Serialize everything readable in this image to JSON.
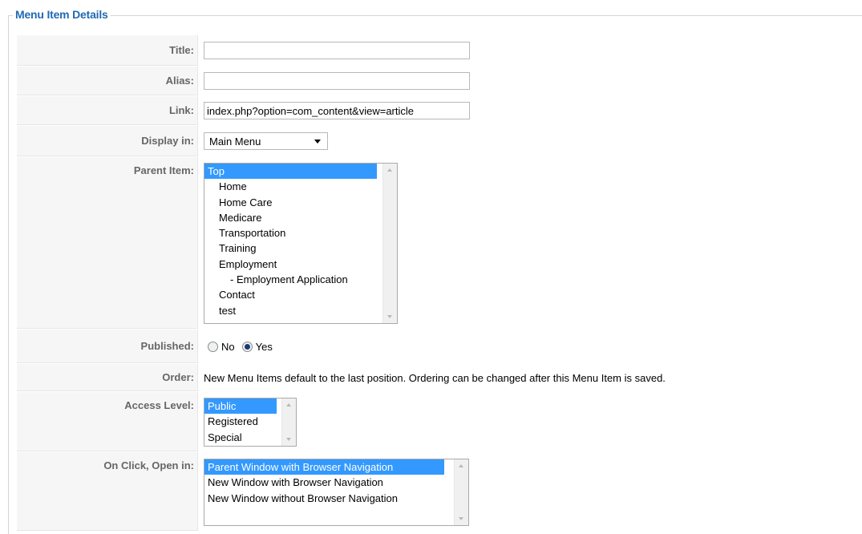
{
  "legend": "Menu Item Details",
  "fields": {
    "title": {
      "label": "Title:",
      "value": ""
    },
    "alias": {
      "label": "Alias:",
      "value": ""
    },
    "link": {
      "label": "Link:",
      "value": "index.php?option=com_content&view=article"
    },
    "display_in": {
      "label": "Display in:",
      "selected": "Main Menu"
    },
    "parent_item": {
      "label": "Parent Item:",
      "options": [
        "Top",
        "  Home",
        "  Home Care",
        "  Medicare",
        "  Transportation",
        "  Training",
        "  Employment",
        "    - Employment Application",
        "  Contact",
        "  test"
      ],
      "selected_index": 0
    },
    "published": {
      "label": "Published:",
      "options": [
        "No",
        "Yes"
      ],
      "selected": "Yes"
    },
    "order": {
      "label": "Order:",
      "text": "New Menu Items default to the last position. Ordering can be changed after this Menu Item is saved."
    },
    "access_level": {
      "label": "Access Level:",
      "options": [
        "Public",
        "Registered",
        "Special"
      ],
      "selected_index": 0
    },
    "on_click": {
      "label": "On Click, Open in:",
      "options": [
        "Parent Window with Browser Navigation",
        "New Window with Browser Navigation",
        "New Window without Browser Navigation"
      ],
      "selected_index": 0
    }
  },
  "colors": {
    "legend": "#1f6ab3",
    "selection": "#3399ff"
  }
}
